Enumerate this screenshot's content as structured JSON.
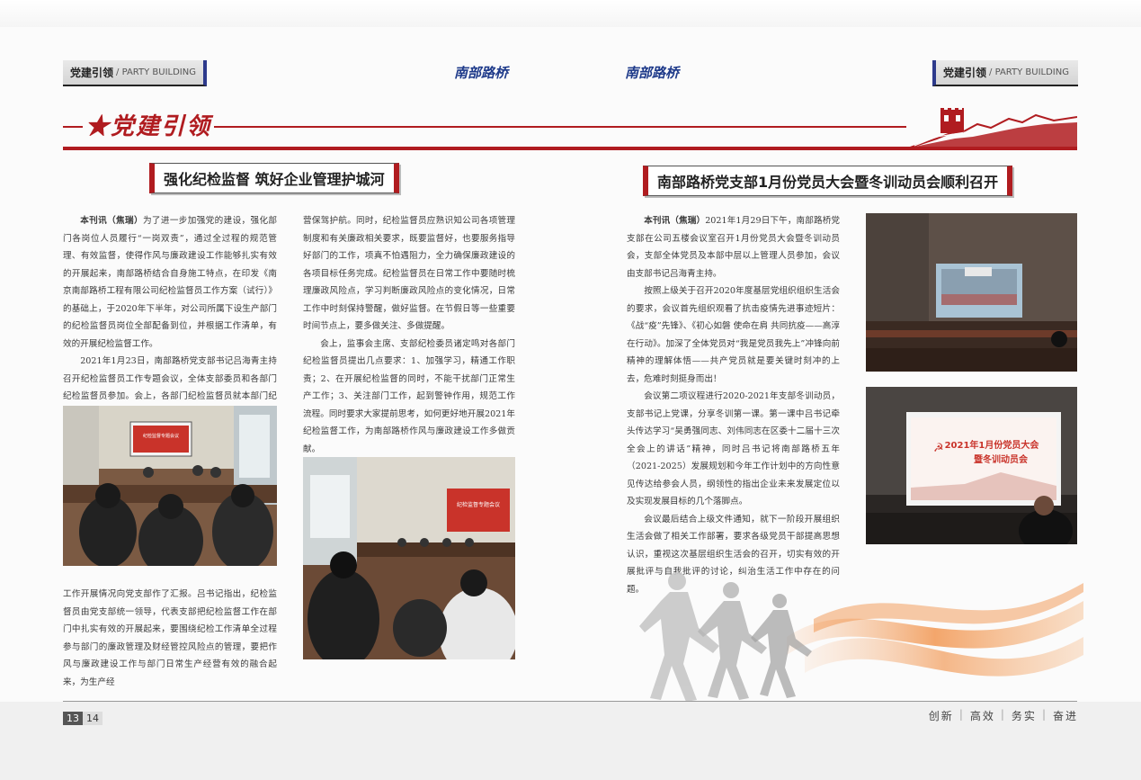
{
  "header": {
    "left_tab_cn": "党建引领",
    "left_tab_en": "/ PARTY BUILDING",
    "right_tab_cn": "党建引领",
    "right_tab_en": "/ PARTY BUILDING",
    "mag_left": "南部路桥",
    "mag_right": "南部路桥"
  },
  "section_title": "★党建引领",
  "left_article": {
    "title": "强化纪检监督 筑好企业管理护城河",
    "col1": [
      {
        "lead": "本刊讯（焦瑞）",
        "text": "为了进一步加强党的建设，强化部门各岗位人员履行“一岗双责”，通过全过程的规范管理、有效监督，使得作风与廉政建设工作能够扎实有效的开展起来，南部路桥结合自身施工特点，在印发《南京南部路桥工程有限公司纪检监督员工作方案（试行）》的基础上，于2020年下半年，对公司所属下设生产部门的纪检监督员岗位全部配备到位，并根据工作清单，有效的开展纪检监督工作。"
      },
      {
        "lead": "",
        "text": "2021年1月23日，南部路桥党支部书记吕海青主持召开纪检监督员工作专题会议，全体支部委员和各部门纪检监督员参加。会上，各部门纪检监督员就本部门纪检监督"
      }
    ],
    "col1_cont": "工作开展情况向党支部作了汇报。吕书记指出，纪检监督员由党支部统一领导，代表支部把纪检监督工作在部门中扎实有效的开展起来，要围绕纪检工作清单全过程参与部门的廉政管理及财经管控风险点的管理，要把作风与廉政建设工作与部门日常生产经营有效的融合起来，为生产经",
    "col2": [
      {
        "text": "营保驾护航。同时，纪检监督员应熟识知公司各项管理制度和有关廉政相关要求，既要监督好，也要服务指导好部门的工作，项真不怕遇阻力，全力确保廉政建设的各项目标任务完成。纪检监督员在日常工作中要随时梳理廉政风险点，学习判断廉政风险点的变化情况，日常工作中时刻保持警醒，做好监督。在节假日等一些重要时间节点上，要多做关注、多做提醒。",
        "indent": false
      },
      {
        "text": "会上，监事会主席、支部纪检委员诸定鸣对各部门纪检监督员提出几点要求：1、加强学习，精通工作职责；2、在开展纪检监督的同时，不能干扰部门正常生产工作；3、关注部门工作，起到警钟作用，规范工作流程。同时要求大家提前思考，如何更好地开展2021年纪检监督工作，为南部路桥作风与廉政建设工作多做贡献。",
        "indent": true
      }
    ]
  },
  "right_article": {
    "title": "南部路桥党支部1月份党员大会暨冬训动员会顺利召开",
    "paras": [
      {
        "lead": "本刊讯（焦瑞）",
        "text": "2021年1月29日下午，南部路桥党支部在公司五楼会议室召开1月份党员大会暨冬训动员会，支部全体党员及本部中层以上管理人员参加，会议由支部书记吕海青主持。"
      },
      {
        "lead": "",
        "text": "按照上级关于召开2020年度基层党组织组织生活会的要求，会议首先组织观看了抗击疫情先进事迹短片：《战“疫”先锋》、《初心如磐 使命在肩 共同抗疫——高淳在行动》。加深了全体党员对“我是党员我先上”冲锋向前精神的理解体悟——共产党员就是要关键时刻冲的上去，危难时刻挺身而出！"
      },
      {
        "lead": "",
        "text": "会议第二项议程进行2020-2021年支部冬训动员，支部书记上党课，分享冬训第一课。第一课中吕书记牵头传达学习“吴勇强同志、刘伟同志在区委十二届十三次全会上的讲话”精神，同时吕书记将南部路桥五年（2021-2025）发展规划和今年工作计划中的方向性意见传达给参会人员，纲领性的指出企业未来发展定位以及实现发展目标的几个落脚点。"
      },
      {
        "lead": "",
        "text": "会议最后结合上级文件通知，就下一阶段开展组织生活会做了相关工作部署，要求各级党员干部提高思想认识，重视这次基层组织生活会的召开，切实有效的开展批评与自我批评的讨论，纠治生活工作中存在的问题。"
      }
    ],
    "screen_text_1": "2021年1月份党员大会",
    "screen_text_2": "暨冬训动员会"
  },
  "left_photo_screen": "纪检监督专题会议",
  "mid_photo_screen": "纪检监督专题会议",
  "footer": {
    "page_left": "13",
    "page_right": "14",
    "slogan": [
      "创新",
      "高效",
      "务实",
      "奋进"
    ]
  },
  "colors": {
    "accent_red": "#b01c20",
    "nav_blue": "#1e3a8a",
    "tab_bar_blue": "#2d3a8c"
  }
}
